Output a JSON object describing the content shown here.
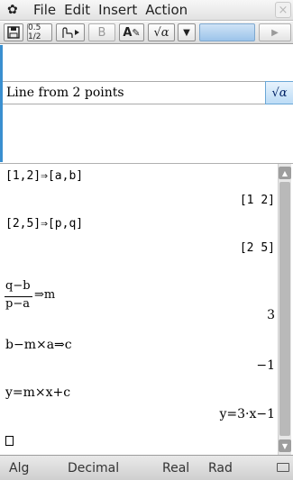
{
  "menubar": {
    "gear_icon": "gear-icon",
    "items": [
      "File",
      "Edit",
      "Insert",
      "Action"
    ],
    "close_label": "×"
  },
  "toolbar": {
    "buttons": [
      {
        "name": "save",
        "icon": "floppy-icon"
      },
      {
        "name": "fraction-decimal",
        "label": "0.5 1/2"
      },
      {
        "name": "stylus",
        "icon": "hand-pointer-icon"
      },
      {
        "name": "bold",
        "label": "B"
      },
      {
        "name": "variable",
        "label": "A"
      },
      {
        "name": "sqrt",
        "label": "√α"
      },
      {
        "name": "dropdown",
        "icon": "triangle-down-icon"
      },
      {
        "name": "next",
        "icon": "play-icon"
      }
    ]
  },
  "entry": {
    "text": "Line from 2 points",
    "key_label": "√α"
  },
  "history": {
    "lines": [
      {
        "in": "[1,2]⇒[a,b]",
        "out": "[1  2]"
      },
      {
        "in": "[2,5]⇒[p,q]",
        "out": "[2  5]"
      },
      {
        "in_num": "q−b",
        "in_den": "p−a",
        "in_rest": "⇒m",
        "out": "3"
      },
      {
        "in": "b−m×a⇒c",
        "out": "−1"
      },
      {
        "in": "y=m×x+c",
        "out": "y=3·x−1"
      }
    ]
  },
  "status": {
    "mode1": "Alg",
    "mode2": "Decimal",
    "mode3": "Real",
    "mode4": "Rad"
  }
}
